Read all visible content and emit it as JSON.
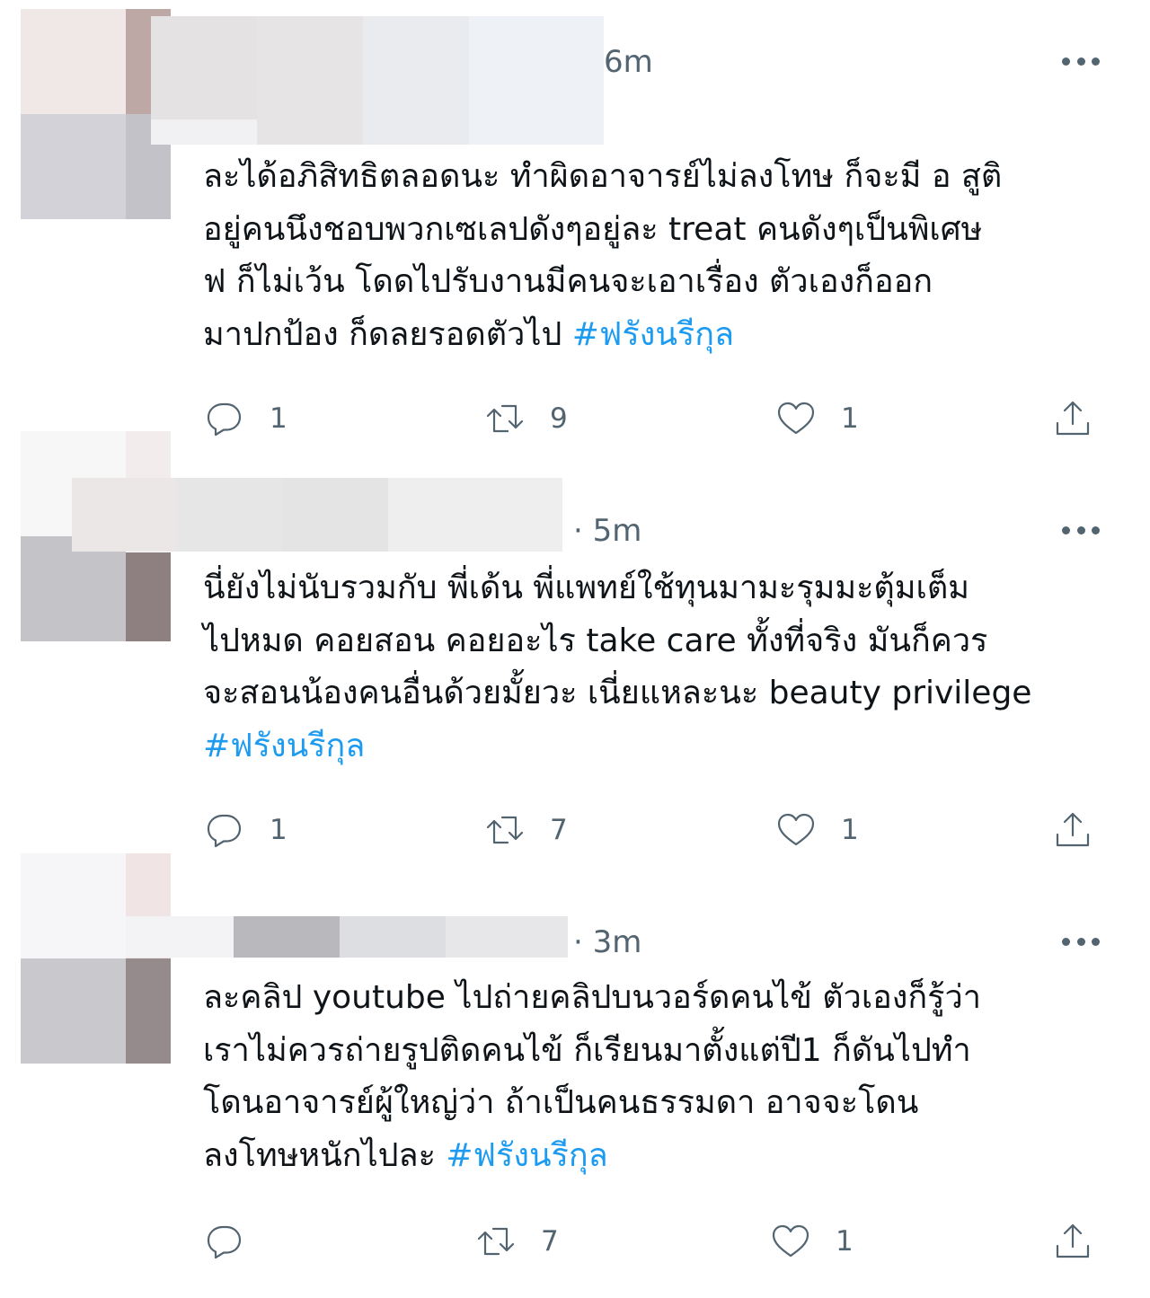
{
  "tweets": [
    {
      "time": "6m",
      "lines": [
        "ละได้อภิสิทธิตลอดนะ ทำผิดอาจารย์ไม่ลงโทษ ก็จะมี อ สูติ",
        "อยู่คนนึงชอบพวกเซเลปดังๆอยู่ละ treat คนดังๆเป็นพิเศษ",
        "ฟ ก็ไม่เว้น โดดไปรับงานมีคนจะเอาเรื่อง ตัวเองก็ออก",
        "มาปกป้อง ก็ดลยรอดตัวไป "
      ],
      "hashtag": "#ฟรังนรีกุล",
      "replies": "1",
      "retweets": "9",
      "likes": "1"
    },
    {
      "time": "· 5m",
      "lines": [
        "นี่ยังไม่นับรวมกับ พี่เด้น พี่แพทย์ใช้ทุนมามะรุมมะตุ้มเต็ม",
        "ไปหมด คอยสอน คอยอะไร take care ทั้งที่จริง มันก็ควร",
        "จะสอนน้องคนอื่นด้วยมั้ยวะ เนี่ยแหละนะ beauty privilege",
        ""
      ],
      "hashtag": "#ฟรังนรีกุล",
      "replies": "1",
      "retweets": "7",
      "likes": "1"
    },
    {
      "time": "· 3m",
      "lines": [
        "ละคลิป youtube ไปถ่ายคลิปบนวอร์ดคนไข้ ตัวเองก็รู้ว่า",
        "เราไม่ควรถ่ายรูปติดคนไข้ ก็เรียนมาตั้งแต่ปี1 ก็ดันไปทำ",
        "โดนอาจารย์ผู้ใหญ่ว่า ถ้าเป็นคนธรรมดา อาจจะโดน",
        "ลงโทษหนักไปละ "
      ],
      "hashtag": "#ฟรังนรีกุล",
      "replies": "",
      "retweets": "7",
      "likes": "1"
    }
  ],
  "colors": {
    "text": "#0f1419",
    "secondary": "#536471",
    "link": "#1d9bf0"
  },
  "icons": [
    "reply-icon",
    "retweet-icon",
    "like-icon",
    "share-icon",
    "more-icon"
  ]
}
